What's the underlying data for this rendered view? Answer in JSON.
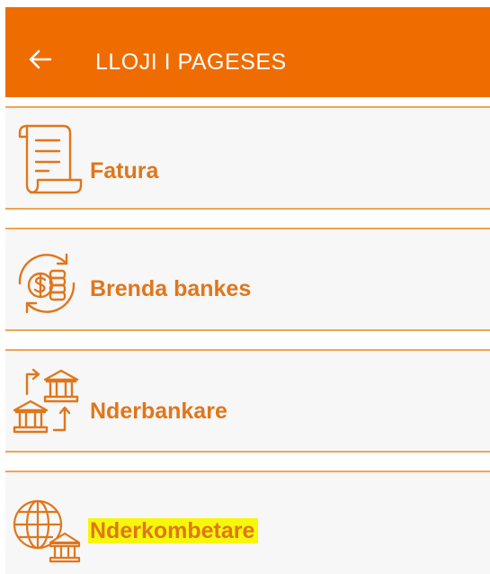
{
  "header": {
    "back_icon": "arrow-left-icon",
    "title": "LLOJI I PAGESES"
  },
  "colors": {
    "header_bg": "#ef6c00",
    "header_text": "#ffffff",
    "item_text": "#e0761b",
    "divider": "#f1a454",
    "highlight": "#f7f70a"
  },
  "payment_types": [
    {
      "label": "Fatura",
      "icon": "invoice-scroll-icon"
    },
    {
      "label": "Brenda bankes",
      "icon": "money-exchange-icon"
    },
    {
      "label": "Nderbankare",
      "icon": "bank-transfer-icon"
    },
    {
      "label": "Nderkombetare",
      "icon": "globe-bank-icon",
      "highlighted": true
    }
  ]
}
